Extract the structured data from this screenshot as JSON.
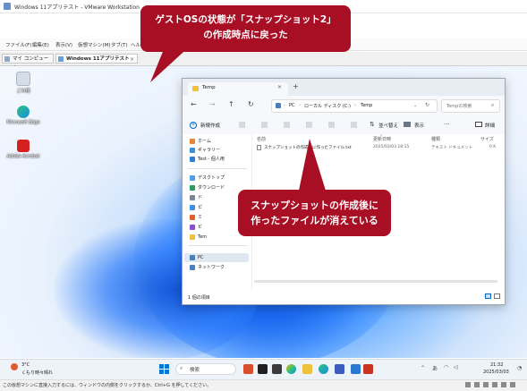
{
  "vm": {
    "window_title": "Windows 11アプリテスト - VMware Workstation",
    "menu": [
      "ファイル(F)",
      "編集(E)",
      "表示(V)",
      "仮想マシン(M)",
      "タブ(T)",
      "ヘルプ"
    ],
    "tabs": [
      {
        "label": "マイ コンピュータ"
      },
      {
        "label": "Windows 11アプリテスト"
      }
    ],
    "status_message": "この仮想マシンに直接入力するには、ウィンドウの内側をクリックするか、Ctrl+G を押してください。"
  },
  "desktop_icons": [
    {
      "label": "ごみ箱",
      "icon": "recycle-bin-icon",
      "color": "#cfd8e3"
    },
    {
      "label": "Microsoft Edge",
      "icon": "edge-icon",
      "color": "#1a8de0"
    },
    {
      "label": "Adobe Acrobat",
      "icon": "acrobat-icon",
      "color": "#d6201f"
    }
  ],
  "explorer": {
    "tab_title": "Temp",
    "address": [
      "PC",
      "ローカル ディスク (C:)",
      "Temp"
    ],
    "search_placeholder": "Tempの検索",
    "new_button": "新規作成",
    "sort_button": "並べ替え",
    "view_button": "表示",
    "details_button": "詳細",
    "sidebar": [
      {
        "label": "ホーム",
        "icon": "home-icon",
        "color": "#e8833a"
      },
      {
        "label": "ギャラリー",
        "icon": "gallery-icon",
        "color": "#3d8fd6"
      },
      {
        "label": "Test - 個人用",
        "icon": "onedrive-icon",
        "color": "#2f7ed8"
      },
      {
        "label": "デスクトップ",
        "icon": "desktop-icon",
        "color": "#4f9fe8"
      },
      {
        "label": "ダウンロード",
        "icon": "downloads-icon",
        "color": "#2d9c5e"
      },
      {
        "label": "ド",
        "icon": "documents-icon",
        "color": "#7a8796"
      },
      {
        "label": "ピ",
        "icon": "pictures-icon",
        "color": "#3a8fde"
      },
      {
        "label": "ミ",
        "icon": "music-icon",
        "color": "#e0612f"
      },
      {
        "label": "ビ",
        "icon": "videos-icon",
        "color": "#8a4fd0"
      },
      {
        "label": "Tem",
        "icon": "folder-icon",
        "color": "#f0c23b"
      },
      {
        "label": "PC",
        "icon": "pc-icon",
        "color": "#4a7fc1"
      },
      {
        "label": "ネットワーク",
        "icon": "network-icon",
        "color": "#4a7fc1"
      }
    ],
    "columns": [
      "名前",
      "更新日時",
      "種類",
      "サイズ"
    ],
    "files": [
      {
        "name": "スナップショットの作成前に作ったファイル.txt",
        "modified": "2025/03/03 18:15",
        "type": "テキスト ドキュメント",
        "size": "0 K"
      }
    ],
    "item_count": "1 個の項目"
  },
  "callouts": {
    "top_line1": "ゲストOSの状態が「スナップショット2」",
    "top_line2": "の作成時点に戻った",
    "mid_line1": "スナップショットの作成後に",
    "mid_line2": "作ったファイルが消えている"
  },
  "taskbar": {
    "weather_temp": "3°C",
    "weather_text": "くもり時々晴れ",
    "search_placeholder": "検索",
    "time": "21:32",
    "date": "2025/03/03"
  },
  "colors": {
    "callout": "#a80e24",
    "accent": "#0067c0"
  }
}
